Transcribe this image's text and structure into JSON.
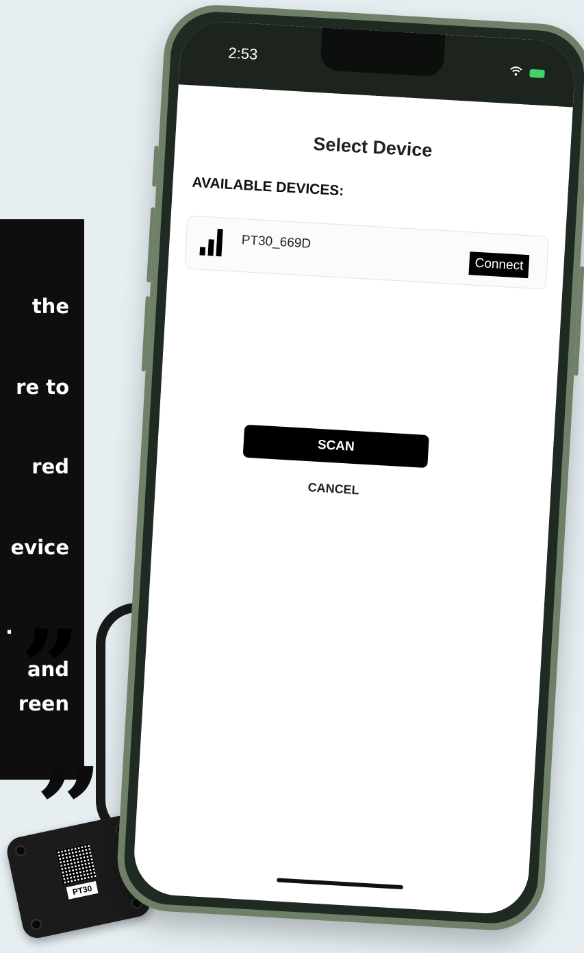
{
  "caption": {
    "lines": [
      "the",
      "re to",
      "red",
      "evice",
      ".",
      "and",
      "reen"
    ],
    "quote_glyph": "”"
  },
  "phone": {
    "status": {
      "time": "2:53"
    },
    "screen": {
      "title": "Select Device",
      "section_label": "AVAILABLE DEVICES:",
      "devices": [
        {
          "name": "PT30_669D",
          "action": "Connect",
          "icon": "signal-strength-icon"
        }
      ],
      "scan_label": "SCAN",
      "cancel_label": "CANCEL"
    }
  },
  "hardware": {
    "label": "PT30"
  },
  "colors": {
    "background": "#e6eef2",
    "panel": "#0e0e0e",
    "phone_frame": "#6f8069",
    "button": "#000000",
    "battery": "#3fd46a"
  }
}
